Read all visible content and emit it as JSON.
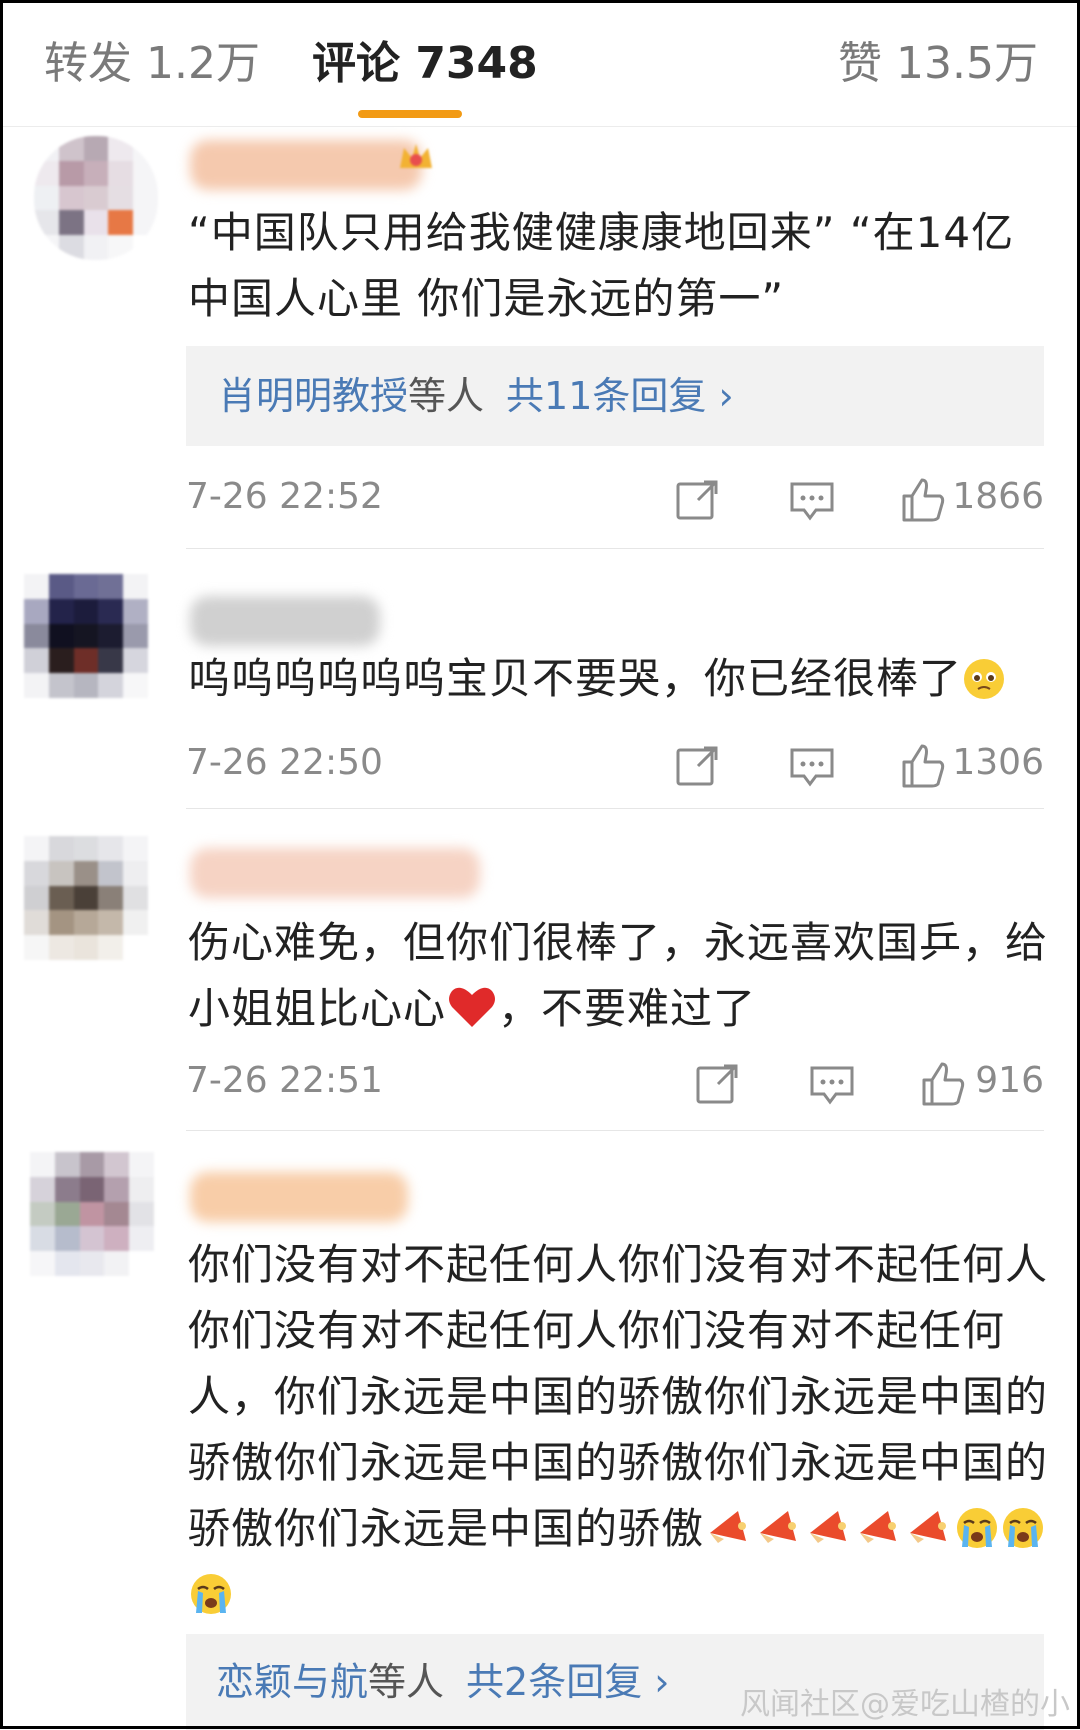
{
  "tabs": {
    "repost": "转发 1.2万",
    "comments": "评论 7348",
    "likes": "赞 13.5万"
  },
  "comments": [
    {
      "text": "“中国队只用给我健健康康地回来” “在14亿中国人心里 你们是永远的第一”",
      "replies": {
        "user": "肖明明教授",
        "suffix": "等人",
        "count": "共11条回复 ›"
      },
      "time": "7-26 22:52",
      "likes": "1866"
    },
    {
      "text": "呜呜呜呜呜呜宝贝不要哭，你已经很棒了",
      "emoji": "pleading-face-emoji",
      "time": "7-26 22:50",
      "likes": "1306"
    },
    {
      "text_a": "伤心难免，但你们很棒了，永远喜欢国乒，给小姐姐比心心",
      "text_b": "，不要难过了",
      "emoji": "red-heart-emoji",
      "time": "7-26 22:51",
      "likes": "916"
    },
    {
      "text": "你们没有对不起任何人你们没有对不起任何人你们没有对不起任何人你们没有对不起任何人，你们永远是中国的骄傲你们永远是中国的骄傲你们永远是中国的骄傲你们永远是中国的骄傲你们永远是中国的骄傲",
      "emojis": [
        "megaphone-emoji",
        "megaphone-emoji",
        "megaphone-emoji",
        "megaphone-emoji",
        "megaphone-emoji",
        "crying-face-emoji",
        "crying-face-emoji",
        "crying-face-emoji"
      ],
      "replies": {
        "user": "恋颖与航",
        "suffix": "等人",
        "count": "共2条回复 ›"
      }
    }
  ],
  "watermark": "风闻社区@爱吃山楂的小",
  "colors": {
    "accent": "#f29a14",
    "link": "#4a7ab5",
    "meta": "#8a8a8a"
  }
}
